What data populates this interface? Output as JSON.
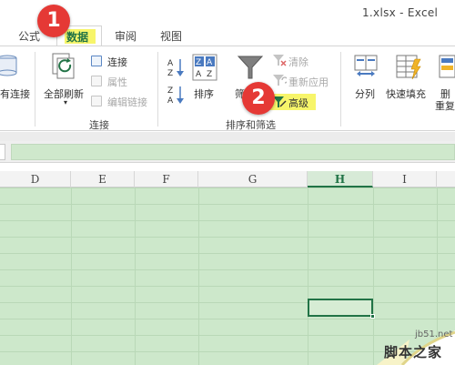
{
  "window": {
    "title": "1.xlsx - Excel"
  },
  "tabs": [
    {
      "label": "公式"
    },
    {
      "label": "数据"
    },
    {
      "label": "审阅"
    },
    {
      "label": "视图"
    }
  ],
  "ribbon": {
    "existing_connections": "有连接",
    "connections_group": {
      "refresh_all": "全部刷新",
      "connections": "连接",
      "properties": "属性",
      "edit_links": "编辑链接",
      "label": "连接"
    },
    "sort_filter_group": {
      "sort": "排序",
      "filter": "筛",
      "clear": "清除",
      "reapply": "重新应用",
      "advanced": "高级",
      "label": "排序和筛选"
    },
    "data_tools": {
      "text_to_columns": "分列",
      "flash_fill": "快速填充",
      "remove_dup_top": "删",
      "remove_dup_bottom": "重复"
    }
  },
  "columns": [
    {
      "label": "D"
    },
    {
      "label": "E"
    },
    {
      "label": "F"
    },
    {
      "label": "G"
    },
    {
      "label": "H",
      "selected": true
    },
    {
      "label": "I"
    }
  ],
  "badges": {
    "step1": "1",
    "step2": "2"
  },
  "watermark": {
    "url": "jb51.net",
    "text": "脚本之家"
  },
  "colors": {
    "accent": "#217346",
    "badge": "#e53935",
    "highlight": "#f7f56a",
    "selection": "#cde8cb"
  }
}
